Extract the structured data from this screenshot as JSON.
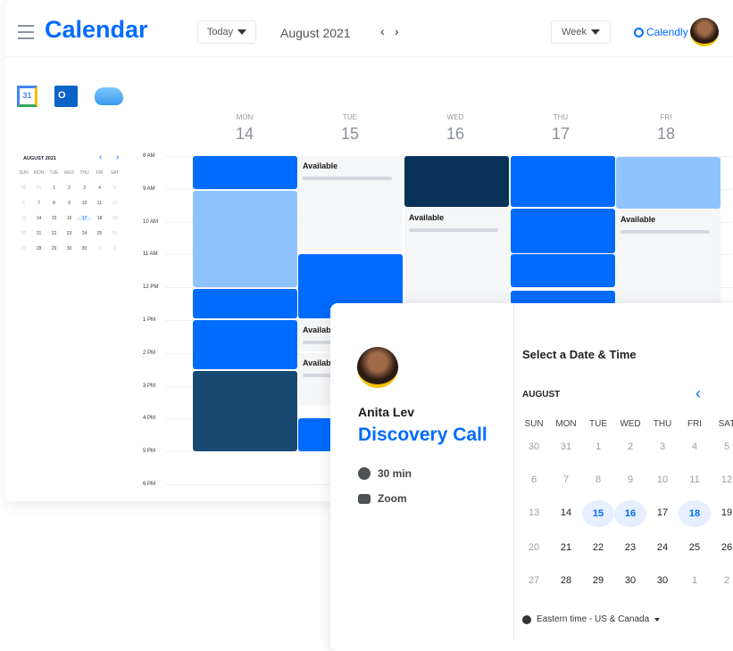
{
  "header": {
    "title": "Calendar",
    "today_label": "Today",
    "month_label": "August 2021",
    "view_label": "Week",
    "brand": "Calendly"
  },
  "integrations": [
    "google-calendar-icon",
    "outlook-icon",
    "icloud-icon"
  ],
  "mini_calendar": {
    "title": "AUGUST 2021",
    "weekdays": [
      "SUN",
      "MON",
      "TUE",
      "WED",
      "THU",
      "FRI",
      "SAT"
    ],
    "weeks": [
      [
        "30",
        "31",
        "1",
        "2",
        "3",
        "4",
        "5"
      ],
      [
        "6",
        "7",
        "8",
        "9",
        "10",
        "11",
        "12"
      ],
      [
        "13",
        "14",
        "15",
        "16",
        "17",
        "18",
        "19"
      ],
      [
        "20",
        "21",
        "22",
        "23",
        "24",
        "25",
        "26"
      ],
      [
        "27",
        "28",
        "29",
        "30",
        "30",
        "1",
        "2"
      ]
    ],
    "selected": "17"
  },
  "week": {
    "days": [
      {
        "name": "MON",
        "num": "14"
      },
      {
        "name": "TUE",
        "num": "15"
      },
      {
        "name": "WED",
        "num": "16"
      },
      {
        "name": "THU",
        "num": "17"
      },
      {
        "name": "FRI",
        "num": "18"
      }
    ],
    "times": [
      "8 AM",
      "9 AM",
      "10 AM",
      "11 AM",
      "12 PM",
      "1 PM",
      "2 PM",
      "3 PM",
      "4 PM",
      "5 PM",
      "6 PM"
    ],
    "available_label": "Available"
  },
  "colors": {
    "blue": "#006bff",
    "light_blue": "#8ec3ff",
    "navy": "#0a3157"
  },
  "booking": {
    "host": "Anita Lev",
    "event": "Discovery Call",
    "duration": "30 min",
    "location": "Zoom",
    "heading": "Select a Date & Time",
    "month": "AUGUST",
    "weekdays": [
      "SUN",
      "MON",
      "TUE",
      "WED",
      "THU",
      "FRI",
      "SAT"
    ],
    "weeks": [
      [
        "30",
        "31",
        "1",
        "2",
        "3",
        "4",
        "5"
      ],
      [
        "6",
        "7",
        "8",
        "9",
        "10",
        "11",
        "12"
      ],
      [
        "13",
        "14",
        "15",
        "16",
        "17",
        "18",
        "19"
      ],
      [
        "20",
        "21",
        "22",
        "23",
        "24",
        "25",
        "26"
      ],
      [
        "27",
        "28",
        "29",
        "30",
        "30",
        "1",
        "2"
      ]
    ],
    "available_dates": [
      "15",
      "16",
      "18"
    ],
    "timezone": "Eastern time - US & Canada"
  }
}
